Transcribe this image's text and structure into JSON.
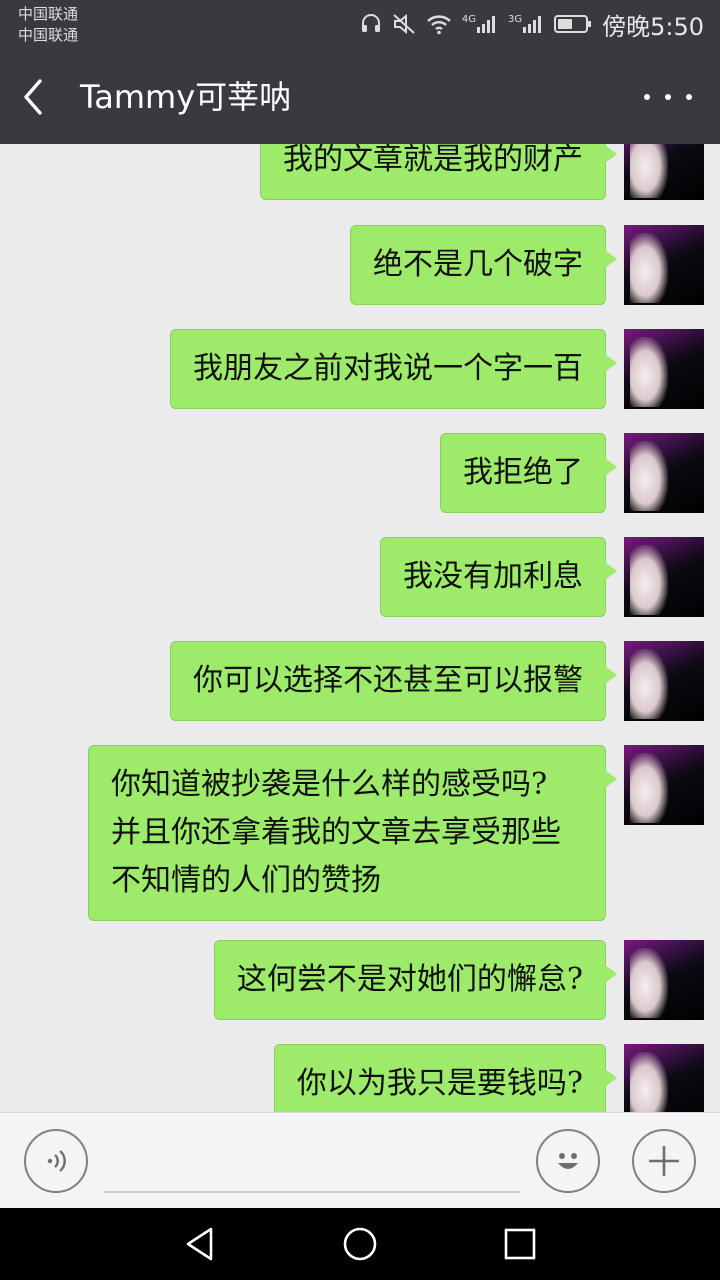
{
  "status_bar": {
    "carrier_1": "中国联通",
    "carrier_2": "中国联通",
    "network_1": "4G",
    "network_2": "3G",
    "time": "傍晚5:50"
  },
  "header": {
    "title": "Tammy可莘呐"
  },
  "messages": [
    {
      "text": "我的文章就是我的财产"
    },
    {
      "text": "绝不是几个破字"
    },
    {
      "text": "我朋友之前对我说一个字一百"
    },
    {
      "text": "我拒绝了"
    },
    {
      "text": "我没有加利息"
    },
    {
      "text": "你可以选择不还甚至可以报警"
    },
    {
      "text": "你知道被抄袭是什么样的感受吗?\n并且你还拿着我的文章去享受那些\n不知情的人们的赞扬"
    },
    {
      "text": "这何尝不是对她们的懈怠?"
    },
    {
      "text": "你以为我只是要钱吗?"
    }
  ],
  "colors": {
    "header_bg": "#393a3f",
    "chat_bg": "#ebebeb",
    "bubble_bg": "#9eea6a"
  }
}
